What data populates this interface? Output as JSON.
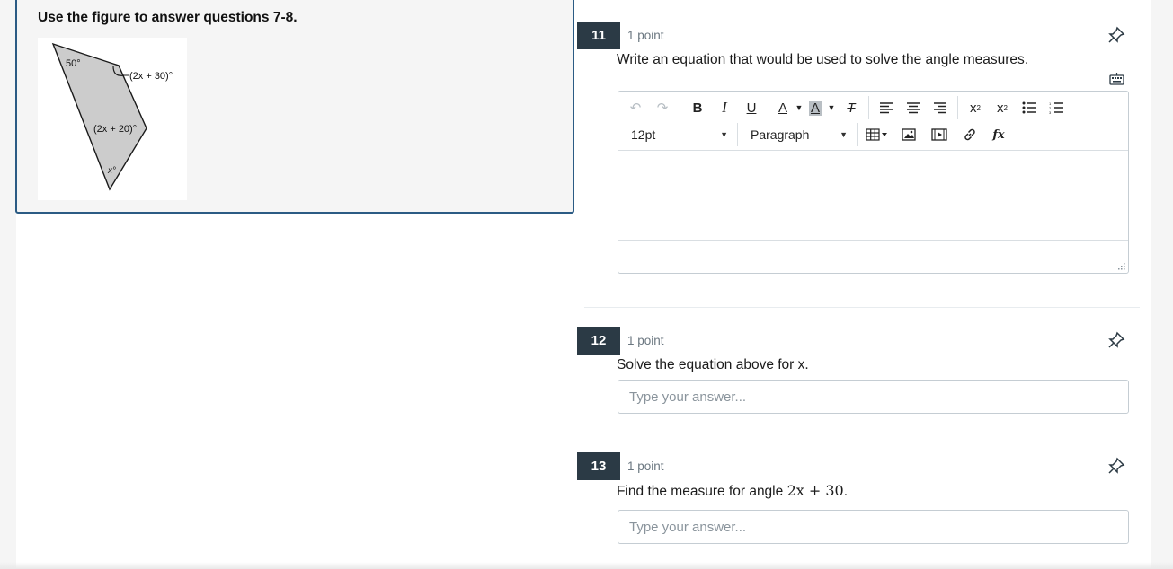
{
  "stimulus": {
    "title": "Use the figure to answer questions 7-8.",
    "figure": {
      "labels": {
        "top": "50°",
        "upper_right": "(2x + 30)°",
        "middle": "(2x + 20)°",
        "bottom": "x°"
      }
    }
  },
  "questions": [
    {
      "number": "11",
      "points": "1 point",
      "prompt": "Write an equation that would be used to solve the angle measures.",
      "editor": {
        "font_size": "12pt",
        "block_format": "Paragraph",
        "toolbar_icons": [
          "undo-icon",
          "redo-icon",
          "bold-icon",
          "italic-icon",
          "underline-icon",
          "text-color-icon",
          "highlight-color-icon",
          "clear-formatting-icon",
          "align-left-icon",
          "align-center-icon",
          "align-right-icon",
          "superscript-icon",
          "subscript-icon",
          "bullet-list-icon",
          "numbered-list-icon",
          "table-icon",
          "image-icon",
          "media-icon",
          "link-icon",
          "equation-icon"
        ]
      }
    },
    {
      "number": "12",
      "points": "1 point",
      "prompt": "Solve the equation above for x.",
      "placeholder": "Type your answer..."
    },
    {
      "number": "13",
      "points": "1 point",
      "prompt": "Find the measure for angle ",
      "prompt_math": "2x + 30",
      "prompt_end": ".",
      "placeholder": "Type your answer..."
    }
  ],
  "colors": {
    "question_number_bg": "#2b3a45",
    "stimulus_border": "#2b5b84",
    "figure_fill": "#cccccc"
  }
}
